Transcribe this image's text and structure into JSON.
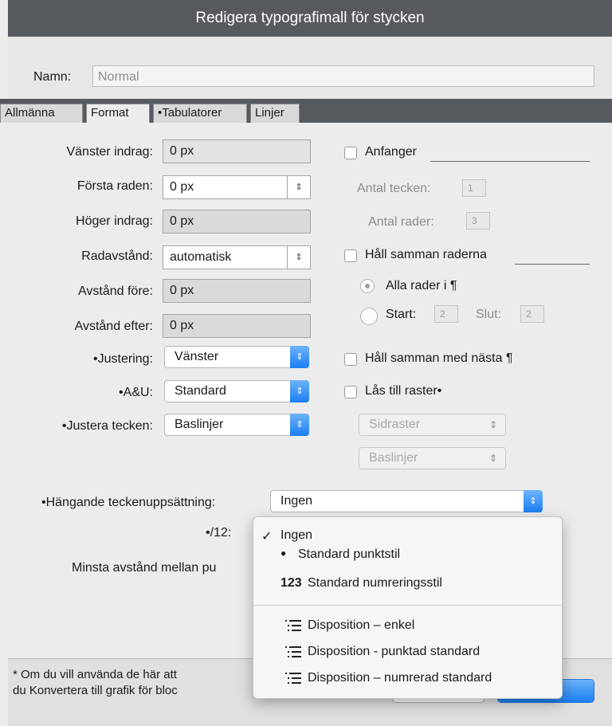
{
  "window": {
    "title": "Redigera typografimall för stycken"
  },
  "name": {
    "label": "Namn:",
    "value": "Normal"
  },
  "tabs": [
    "Allmänna",
    "Format",
    "•Tabulatorer",
    "Linjer"
  ],
  "left": {
    "vanster_indrag": {
      "label": "Vänster indrag:",
      "value": "0 px"
    },
    "forsta_raden": {
      "label": "Första raden:",
      "value": "0 px"
    },
    "hoger_indrag": {
      "label": "Höger indrag:",
      "value": "0 px"
    },
    "radavstand": {
      "label": "Radavstånd:",
      "value": "automatisk"
    },
    "avstand_fore": {
      "label": "Avstånd före:",
      "value": "0 px"
    },
    "avstand_efter": {
      "label": "Avstånd efter:",
      "value": "0 px"
    },
    "justering": {
      "label": "•Justering:",
      "value": "Vänster"
    },
    "au": {
      "label": "•A&U:",
      "value": "Standard"
    },
    "justera_tecken": {
      "label": "•Justera tecken:",
      "value": "Baslinjer"
    }
  },
  "right": {
    "anfanger": "Anfanger",
    "antal_tecken": {
      "label": "Antal tecken:",
      "value": "1"
    },
    "antal_rader": {
      "label": "Antal rader:",
      "value": "3"
    },
    "hall_samman_raderna": "Håll samman raderna",
    "alla_rader": "Alla rader i ¶",
    "start": {
      "label": "Start:",
      "value": "2"
    },
    "slut": {
      "label": "Slut:",
      "value": "2"
    },
    "hall_samman_nasta": "Håll samman med nästa ¶",
    "las_till_raster": "Lås till raster•",
    "sidraster": "Sidraster",
    "baslinjer": "Baslinjer"
  },
  "hanging": {
    "label": "•Hängande teckenuppsättning:",
    "value": "Ingen"
  },
  "bullet_label": "•/12:",
  "min_spacing_label": "Minsta avstånd mellan pu",
  "footer": {
    "line1": "* Om du vill använda de här att",
    "line2": "du Konvertera till grafik för bloc"
  },
  "menu": {
    "items": [
      {
        "label": "Ingen",
        "checked": "✓"
      },
      {
        "label": "Standard punktstil",
        "prefix": "●"
      },
      {
        "label": "Standard numreringsstil",
        "prefix": "123"
      },
      {
        "label": "Disposition – enkel",
        "icon": "outline-list-icon"
      },
      {
        "label": "Disposition - punktad standard",
        "icon": "outline-list-icon"
      },
      {
        "label": "Disposition – numrerad standard",
        "icon": "outline-list-icon"
      }
    ]
  },
  "colors": {
    "titlebar": "#56595e",
    "accent": "#1a7ef2"
  }
}
